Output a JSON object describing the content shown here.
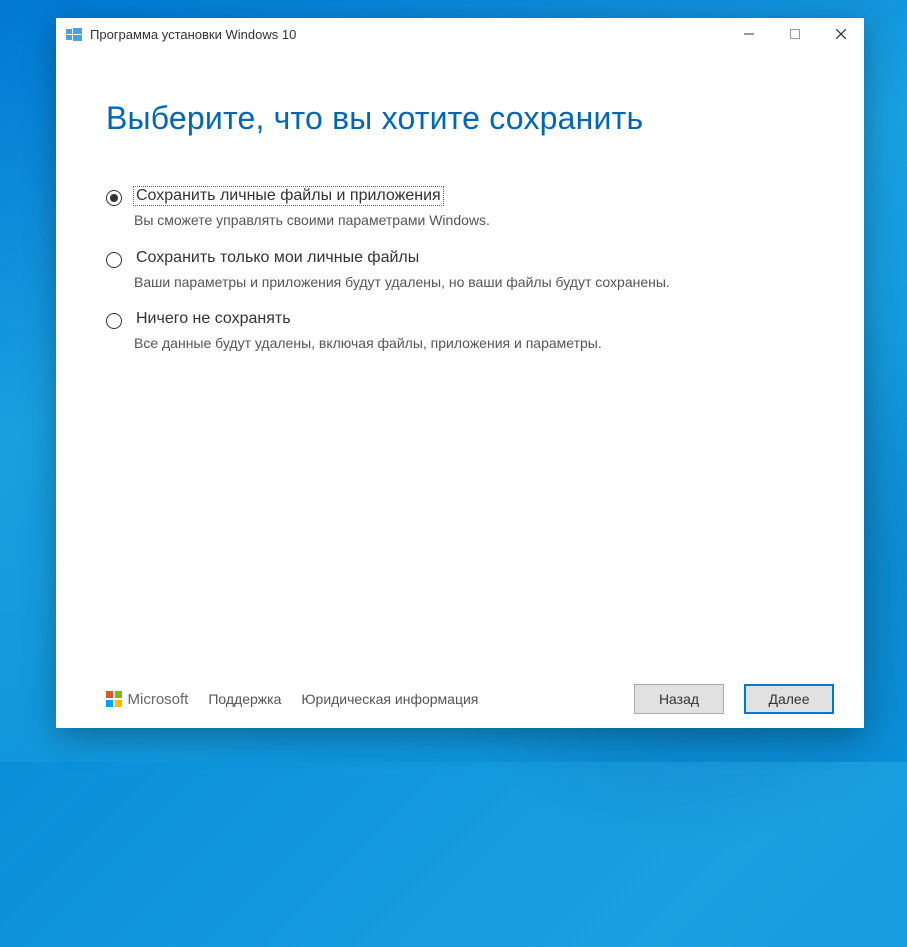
{
  "titlebar": {
    "title": "Программа установки Windows 10"
  },
  "heading": "Выберите, что вы хотите сохранить",
  "options": [
    {
      "label": "Сохранить личные файлы и приложения",
      "desc": "Вы сможете управлять своими параметрами Windows.",
      "checked": true,
      "focused": true
    },
    {
      "label": "Сохранить только мои личные файлы",
      "desc": "Ваши параметры и приложения будут удалены, но ваши файлы будут сохранены.",
      "checked": false,
      "focused": false
    },
    {
      "label": "Ничего не сохранять",
      "desc": "Все данные будут удалены, включая файлы, приложения и параметры.",
      "checked": false,
      "focused": false
    }
  ],
  "footer": {
    "brand": "Microsoft",
    "support": "Поддержка",
    "legal": "Юридическая информация",
    "back": "Назад",
    "next": "Далее"
  }
}
